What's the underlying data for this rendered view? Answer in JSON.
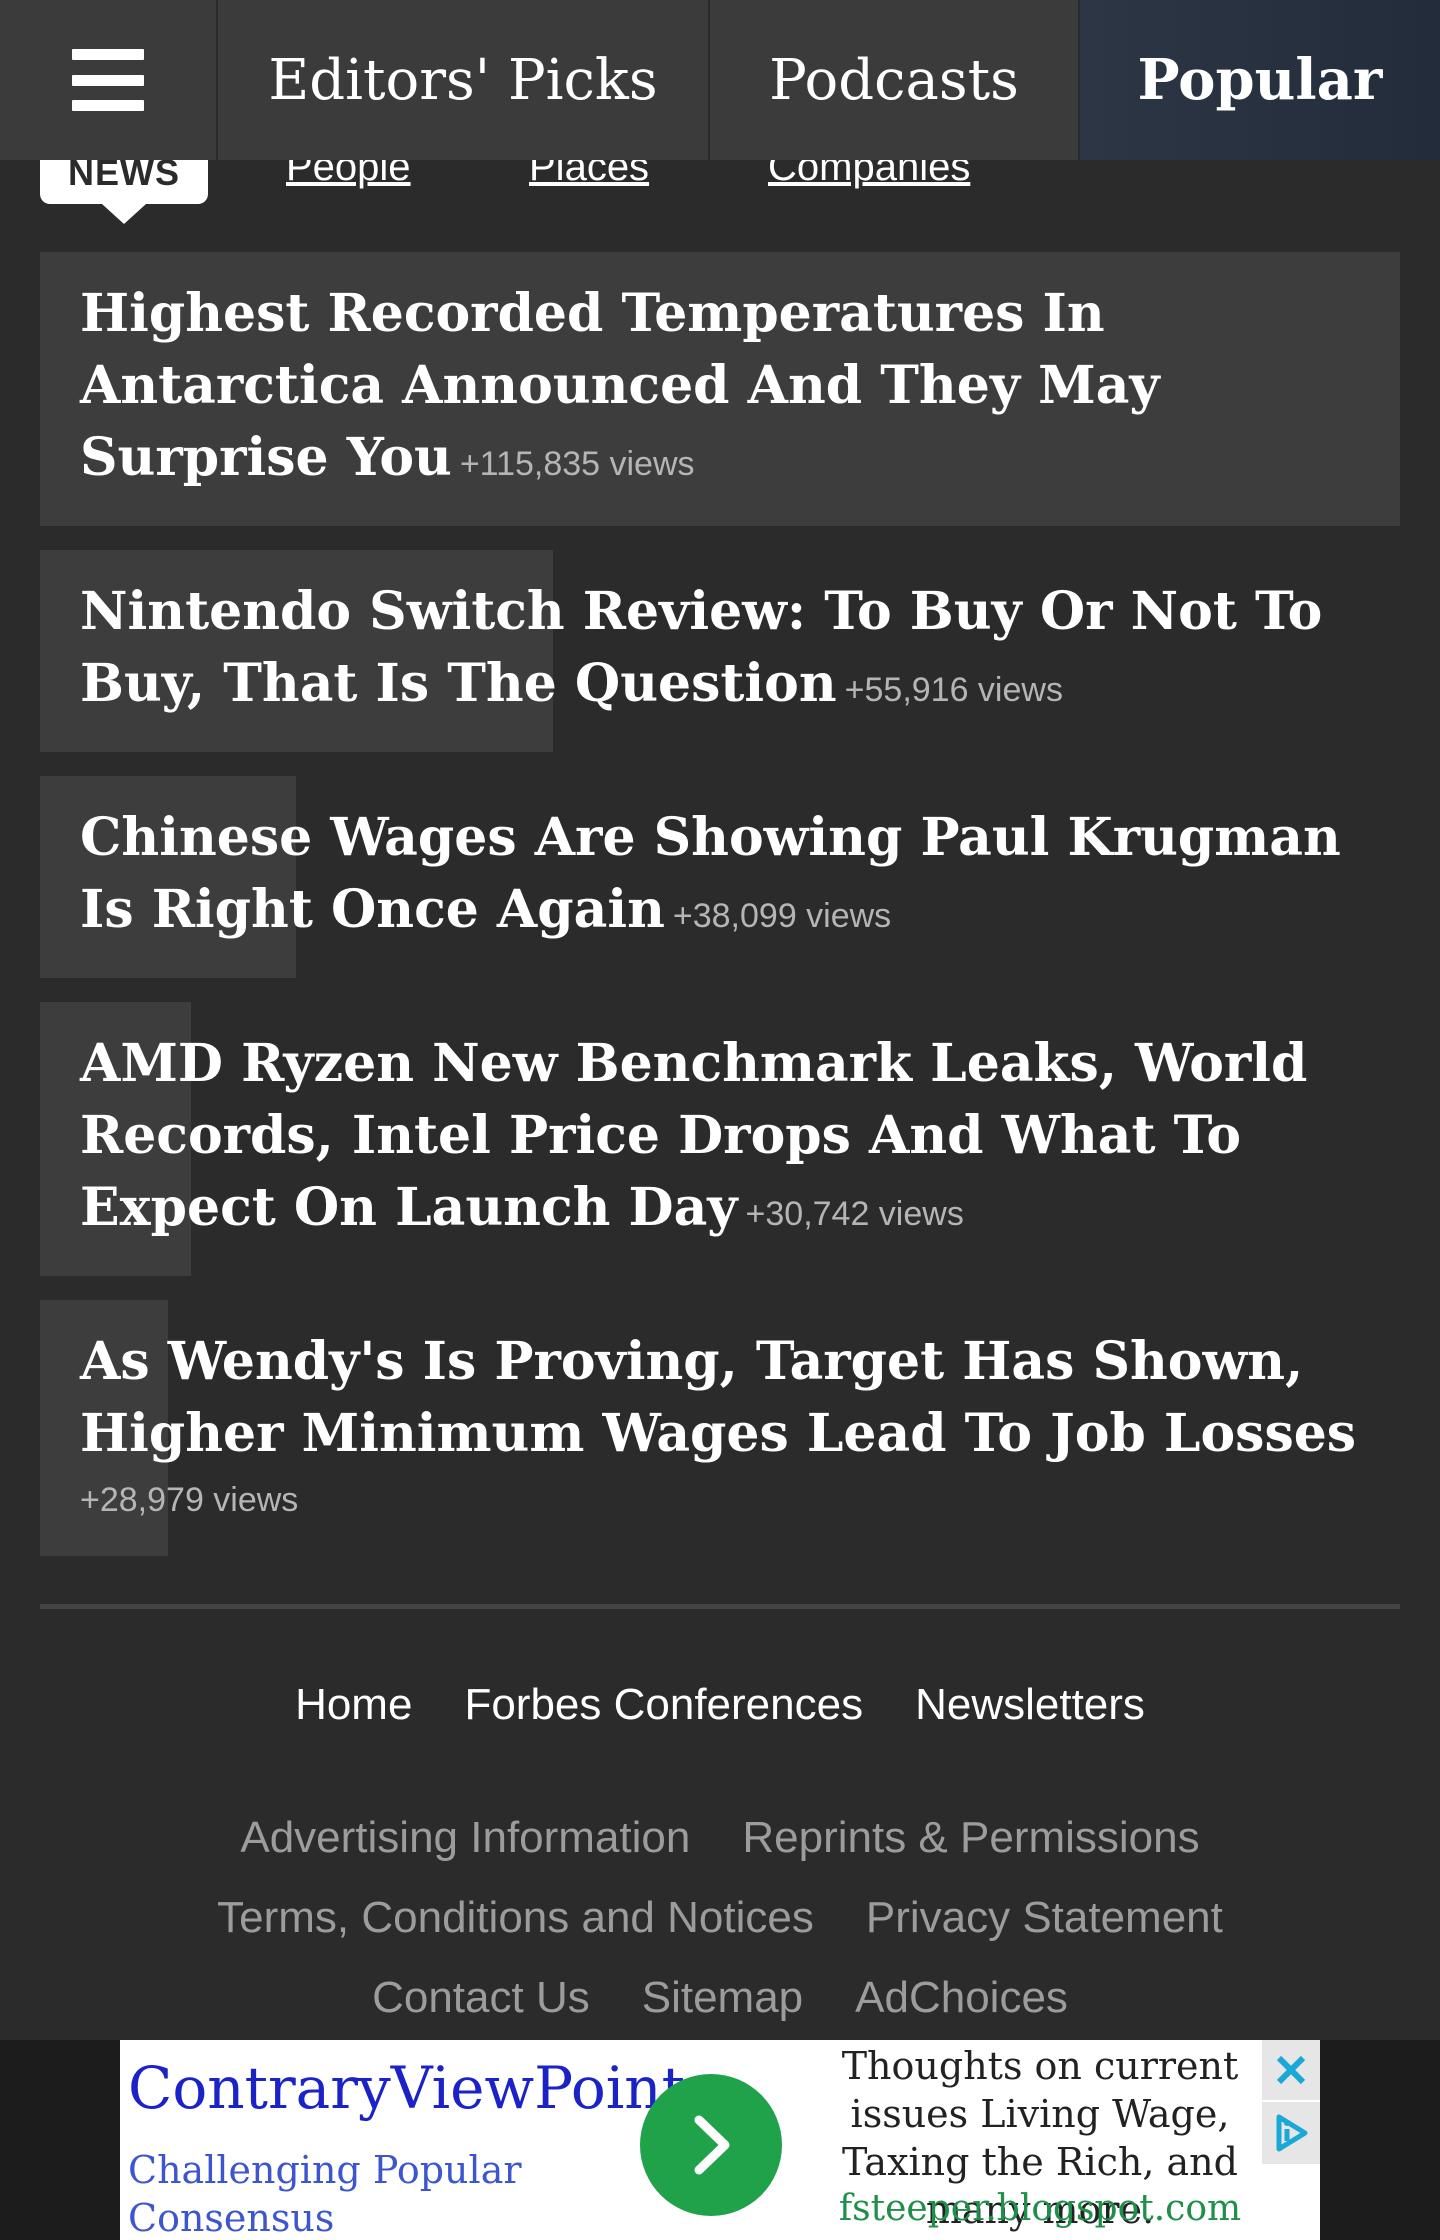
{
  "nav": {
    "menu_icon": "hamburger-menu-icon",
    "tabs": [
      {
        "label": "Editors' Picks"
      },
      {
        "label": "Podcasts"
      },
      {
        "label": "Popular"
      }
    ]
  },
  "subtabs": {
    "active": "NEWS",
    "links": [
      "People",
      "Places",
      "Companies"
    ]
  },
  "popular": {
    "items": [
      {
        "title": "Highest Recorded Temperatures In Antarctica Announced And They May Surprise You",
        "views": "+115,835 views",
        "share": 1.0
      },
      {
        "title": "Nintendo Switch Review: To Buy Or Not To Buy, That Is The Question",
        "views": "+55,916 views",
        "share": 0.377
      },
      {
        "title": "Chinese Wages Are Showing Paul Krugman Is Right Once Again",
        "views": "+38,099 views",
        "share": 0.188
      },
      {
        "title": "AMD Ryzen New Benchmark Leaks, World Records, Intel Price Drops And What To Expect On Launch Day",
        "views": "+30,742 views",
        "share": 0.111
      },
      {
        "title": "As Wendy's Is Proving, Target Has Shown, Higher Minimum Wages Lead To Job Losses",
        "views": "+28,979 views",
        "share": 0.094
      }
    ]
  },
  "footer": {
    "main_links": [
      "Home",
      "Forbes Conferences",
      "Newsletters"
    ],
    "secondary_links": [
      [
        "Advertising Information",
        "Reprints & Permissions"
      ],
      [
        "Terms, Conditions and Notices",
        "Privacy Statement"
      ],
      [
        "Contact Us",
        "Sitemap",
        "AdChoices"
      ]
    ]
  },
  "ad": {
    "title": "ContraryViewPoint",
    "subtitle": "Challenging Popular Consensus",
    "body": "Thoughts on current issues Living Wage, Taxing the Rich, and many more.",
    "url": "fsteeper.blogspot.com",
    "close_icon": "close-icon",
    "adchoices_icon": "adchoices-icon"
  }
}
